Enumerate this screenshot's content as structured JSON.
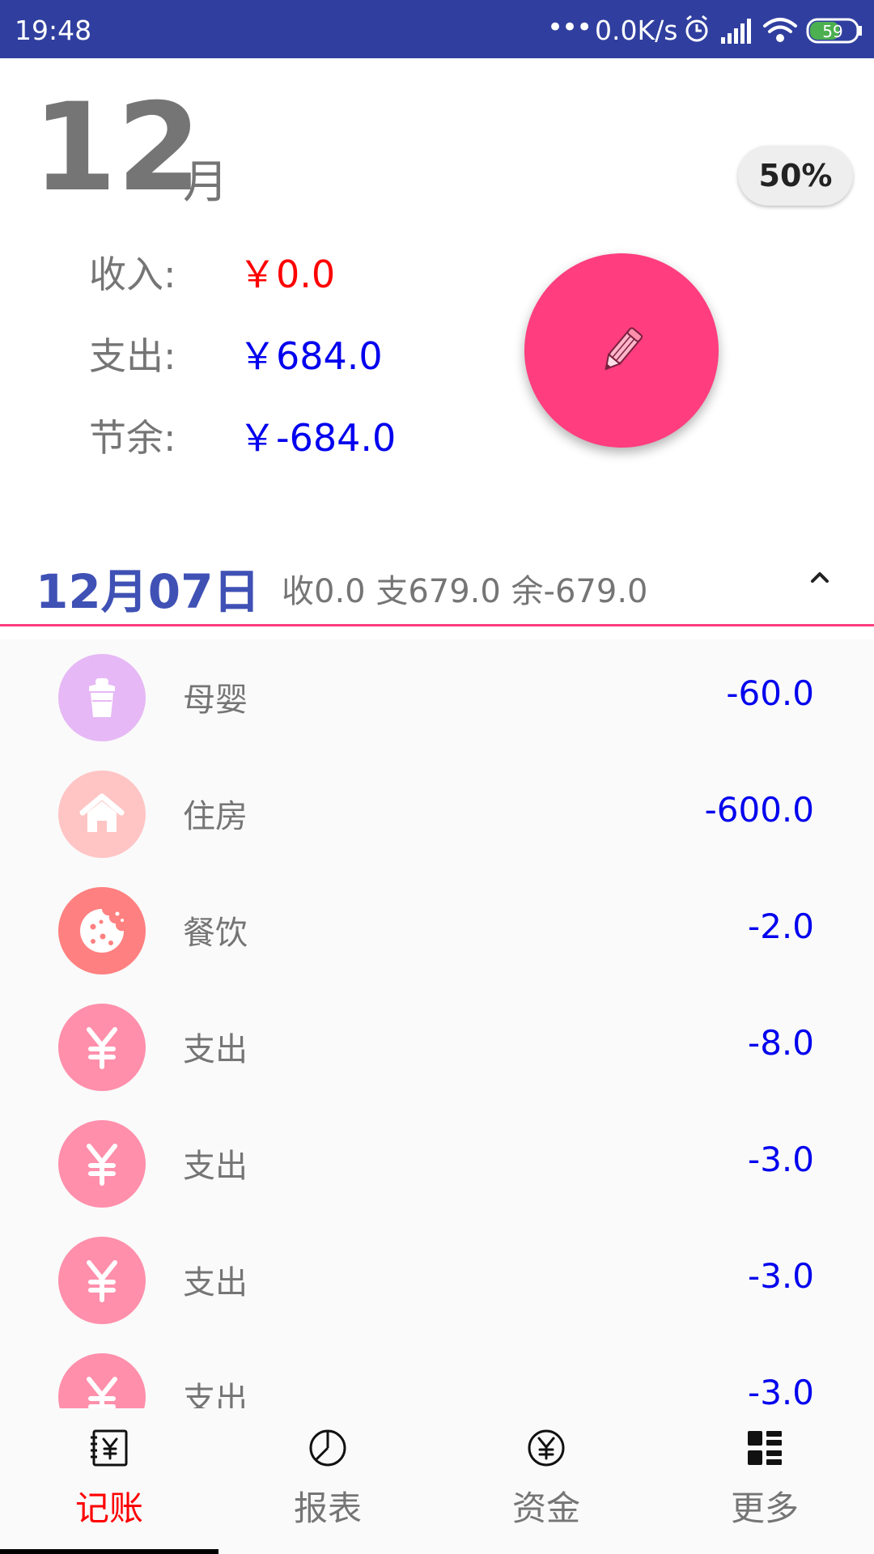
{
  "status_bar": {
    "time": "19:48",
    "dots": "•••",
    "network_speed": "0.0K/s",
    "battery": "59",
    "color": "#303f9f"
  },
  "header": {
    "month_number": "12",
    "month_unit": "月",
    "percent": "50%"
  },
  "summary": {
    "income_label": "收入:",
    "income_value": "￥0.0",
    "expense_label": "支出:",
    "expense_value": "￥684.0",
    "balance_label": "节余:",
    "balance_value": "￥-684.0"
  },
  "fab": {
    "icon": "pencil-icon",
    "color": "#ff3d7f"
  },
  "day": {
    "title": "12月07日",
    "summary": "收0.0 支679.0 余-679.0",
    "collapse_icon": "chevron-up-icon"
  },
  "records": [
    {
      "label": "母婴",
      "amount": "-60.0",
      "icon": "baby-bottle-icon",
      "color": "#e6b8f5"
    },
    {
      "label": "住房",
      "amount": "-600.0",
      "icon": "house-icon",
      "color": "#ffc5c5"
    },
    {
      "label": "餐饮",
      "amount": "-2.0",
      "icon": "cookie-icon",
      "color": "#ff8080"
    },
    {
      "label": "支出",
      "amount": "-8.0",
      "icon": "yen-icon",
      "color": "#ff8fab"
    },
    {
      "label": "支出",
      "amount": "-3.0",
      "icon": "yen-icon",
      "color": "#ff8fab"
    },
    {
      "label": "支出",
      "amount": "-3.0",
      "icon": "yen-icon",
      "color": "#ff8fab"
    },
    {
      "label": "支出",
      "amount": "-3.0",
      "icon": "yen-icon",
      "color": "#ff8fab"
    }
  ],
  "bottom_nav": [
    {
      "label": "记账",
      "icon": "ledger-icon",
      "active": true
    },
    {
      "label": "报表",
      "icon": "pie-chart-icon",
      "active": false
    },
    {
      "label": "资金",
      "icon": "yen-circle-icon",
      "active": false
    },
    {
      "label": "更多",
      "icon": "grid-icon",
      "active": false
    }
  ]
}
